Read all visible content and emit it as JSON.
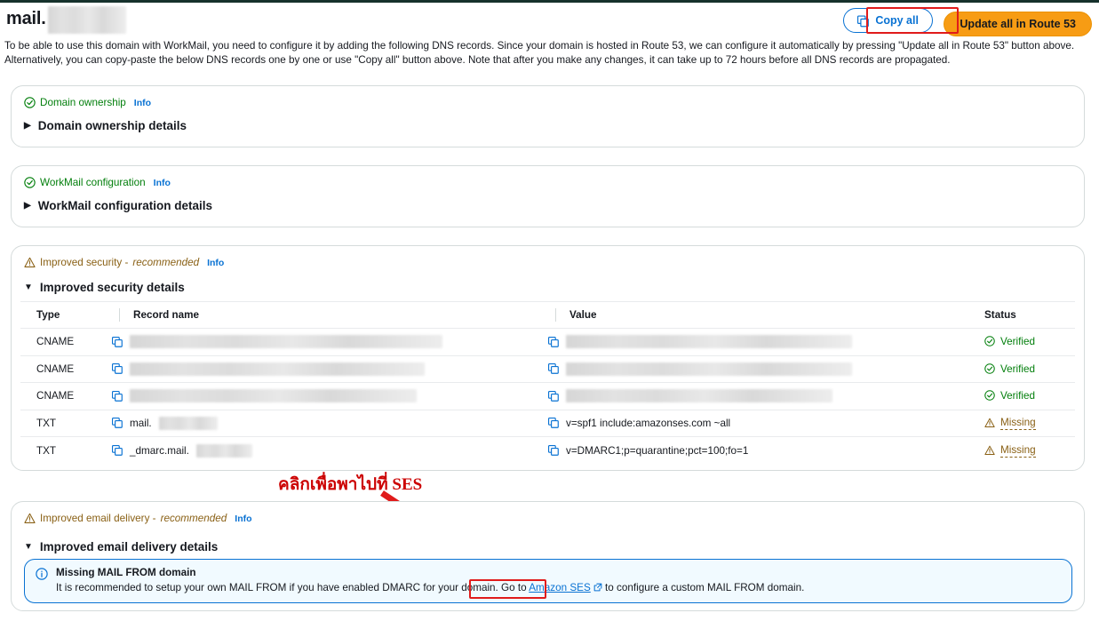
{
  "header": {
    "title_prefix": "mail.",
    "copy_all_label": "Copy all",
    "copy_icon": "copy-icon",
    "update_route53_label": "Update all in Route 53"
  },
  "intro": "To be able to use this domain with WorkMail, you need to configure it by adding the following DNS records. Since your domain is hosted in Route 53, we can configure it automatically by pressing \"Update all in Route 53\" button above. Alternatively, you can copy-paste the below DNS records one by one or use \"Copy all\" button above. Note that after you make any changes, it can take up to 72 hours before all DNS records are propagated.",
  "cards": {
    "ownership": {
      "status_label": "Domain ownership",
      "status_icon": "check-circle-icon",
      "info_label": "Info",
      "expander_label": "Domain ownership details",
      "caret": "▶"
    },
    "workmail": {
      "status_label": "WorkMail configuration",
      "status_icon": "check-circle-icon",
      "info_label": "Info",
      "expander_label": "WorkMail configuration details",
      "caret": "▶"
    },
    "security": {
      "status_label": "Improved security -",
      "status_recommended": "recommended",
      "status_icon": "warning-triangle-icon",
      "info_label": "Info",
      "expander_label": "Improved security details",
      "caret": "▼"
    },
    "delivery": {
      "status_label": "Improved email delivery -",
      "status_recommended": "recommended",
      "status_icon": "warning-triangle-icon",
      "info_label": "Info",
      "expander_label": "Improved email delivery details",
      "caret": "▼"
    }
  },
  "table": {
    "columns": [
      "Type",
      "Record name",
      "Value",
      "Status"
    ],
    "rows": [
      {
        "type": "CNAME",
        "record_name": "",
        "record_redacted": true,
        "record_redact_w": 352,
        "value": "",
        "value_redacted": true,
        "value_redact_w": 322,
        "status": "Verified",
        "status_kind": "ok"
      },
      {
        "type": "CNAME",
        "record_name": "",
        "record_redacted": true,
        "record_redact_w": 332,
        "value": "",
        "value_redacted": true,
        "value_redact_w": 322,
        "status": "Verified",
        "status_kind": "ok"
      },
      {
        "type": "CNAME",
        "record_name": "",
        "record_redacted": true,
        "record_redact_w": 323,
        "value": "",
        "value_redacted": true,
        "value_redact_w": 300,
        "status": "Verified",
        "status_kind": "ok"
      },
      {
        "type": "TXT",
        "record_name": "mail.",
        "record_redacted": true,
        "record_redact_w": 66,
        "value": "v=spf1 include:amazonses.com ~all",
        "value_redacted": false,
        "value_redact_w": 0,
        "status": "Missing",
        "status_kind": "missing"
      },
      {
        "type": "TXT",
        "record_name": "_dmarc.mail.",
        "record_redacted": true,
        "record_redact_w": 63,
        "value": "v=DMARC1;p=quarantine;pct=100;fo=1",
        "value_redacted": false,
        "value_redact_w": 0,
        "status": "Missing",
        "status_kind": "missing"
      }
    ]
  },
  "alert": {
    "icon": "info-circle-icon",
    "title": "Missing MAIL FROM domain",
    "body_before": "It is recommended to setup your own MAIL FROM if you have enabled DMARC for your domain. Go to",
    "link_label": "Amazon SES",
    "link_icon": "external-link-icon",
    "body_after": "to configure a custom MAIL FROM domain."
  },
  "annotation": {
    "text": "คลิกเพื่อพาไปที่ SES",
    "color": "#cc0000"
  },
  "colors": {
    "link": "#0972d3",
    "success": "#037f0c",
    "warning": "#8a6116",
    "primary_button": "#f79c14",
    "annotation": "#e01b1b",
    "top_strip": "#16312c"
  }
}
